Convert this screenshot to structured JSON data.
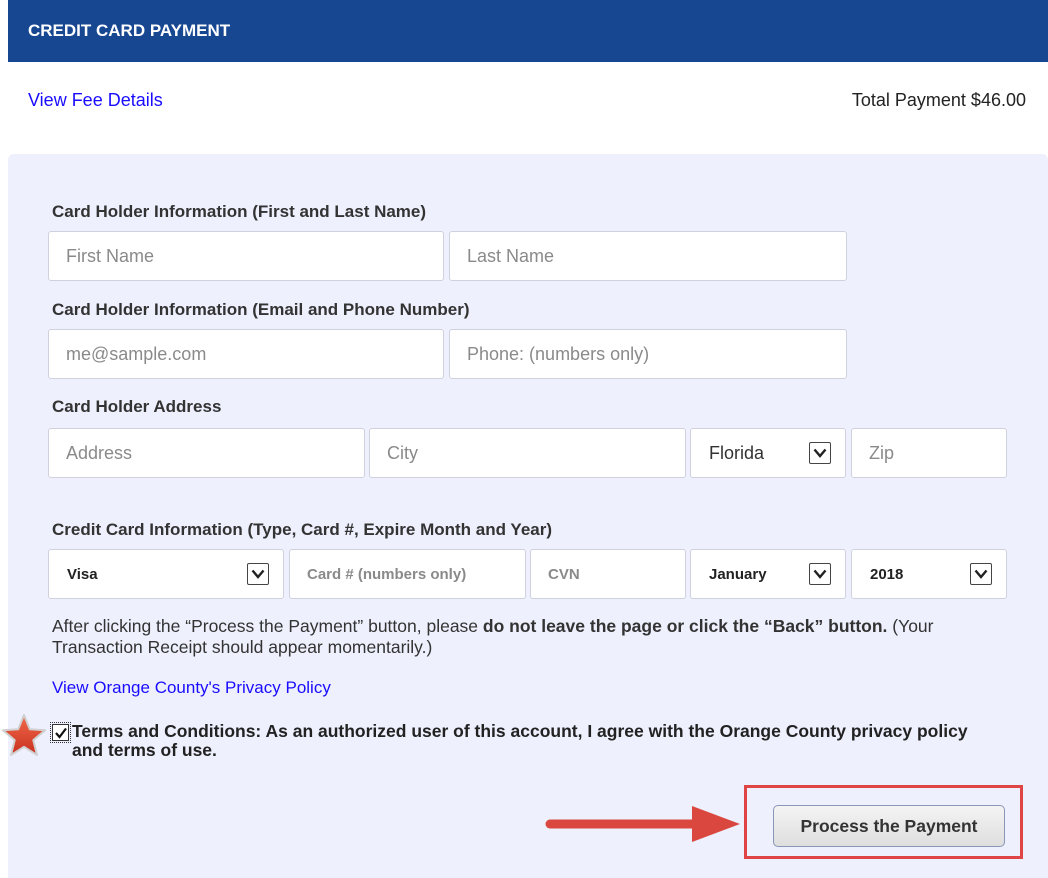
{
  "header": {
    "title": "CREDIT CARD PAYMENT"
  },
  "top": {
    "fee_link": "View Fee Details",
    "total_payment": "Total Payment $46.00"
  },
  "sections": {
    "name_label": "Card Holder Information (First and Last Name)",
    "contact_label": "Card Holder Information (Email and Phone Number)",
    "address_label": "Card Holder Address",
    "card_label": "Credit Card Information (Type, Card #, Expire Month and Year)"
  },
  "fields": {
    "first_name_placeholder": "First Name",
    "last_name_placeholder": "Last Name",
    "email_placeholder": "me@sample.com",
    "phone_placeholder": "Phone: (numbers only)",
    "address_placeholder": "Address",
    "city_placeholder": "City",
    "state_value": "Florida",
    "zip_placeholder": "Zip",
    "card_type_value": "Visa",
    "card_number_placeholder": "Card # (numbers only)",
    "cvn_placeholder": "CVN",
    "expire_month_value": "January",
    "expire_year_value": "2018"
  },
  "note": {
    "part1": "After clicking the “Process the Payment” button, please ",
    "bold": "do not leave the page or click the “Back” button.",
    "part2": " (Your Transaction Receipt should appear momentarily.)"
  },
  "privacy_link": "View Orange County's Privacy Policy",
  "terms": {
    "checked": true,
    "text": "Terms and Conditions: As an authorized user of this account, I agree with the Orange County privacy policy and terms of use."
  },
  "submit_label": "Process the Payment",
  "colors": {
    "header_bg": "#184792",
    "panel_bg": "#eef0fd",
    "link": "#1a0dff",
    "annotation_red": "#e04545"
  }
}
